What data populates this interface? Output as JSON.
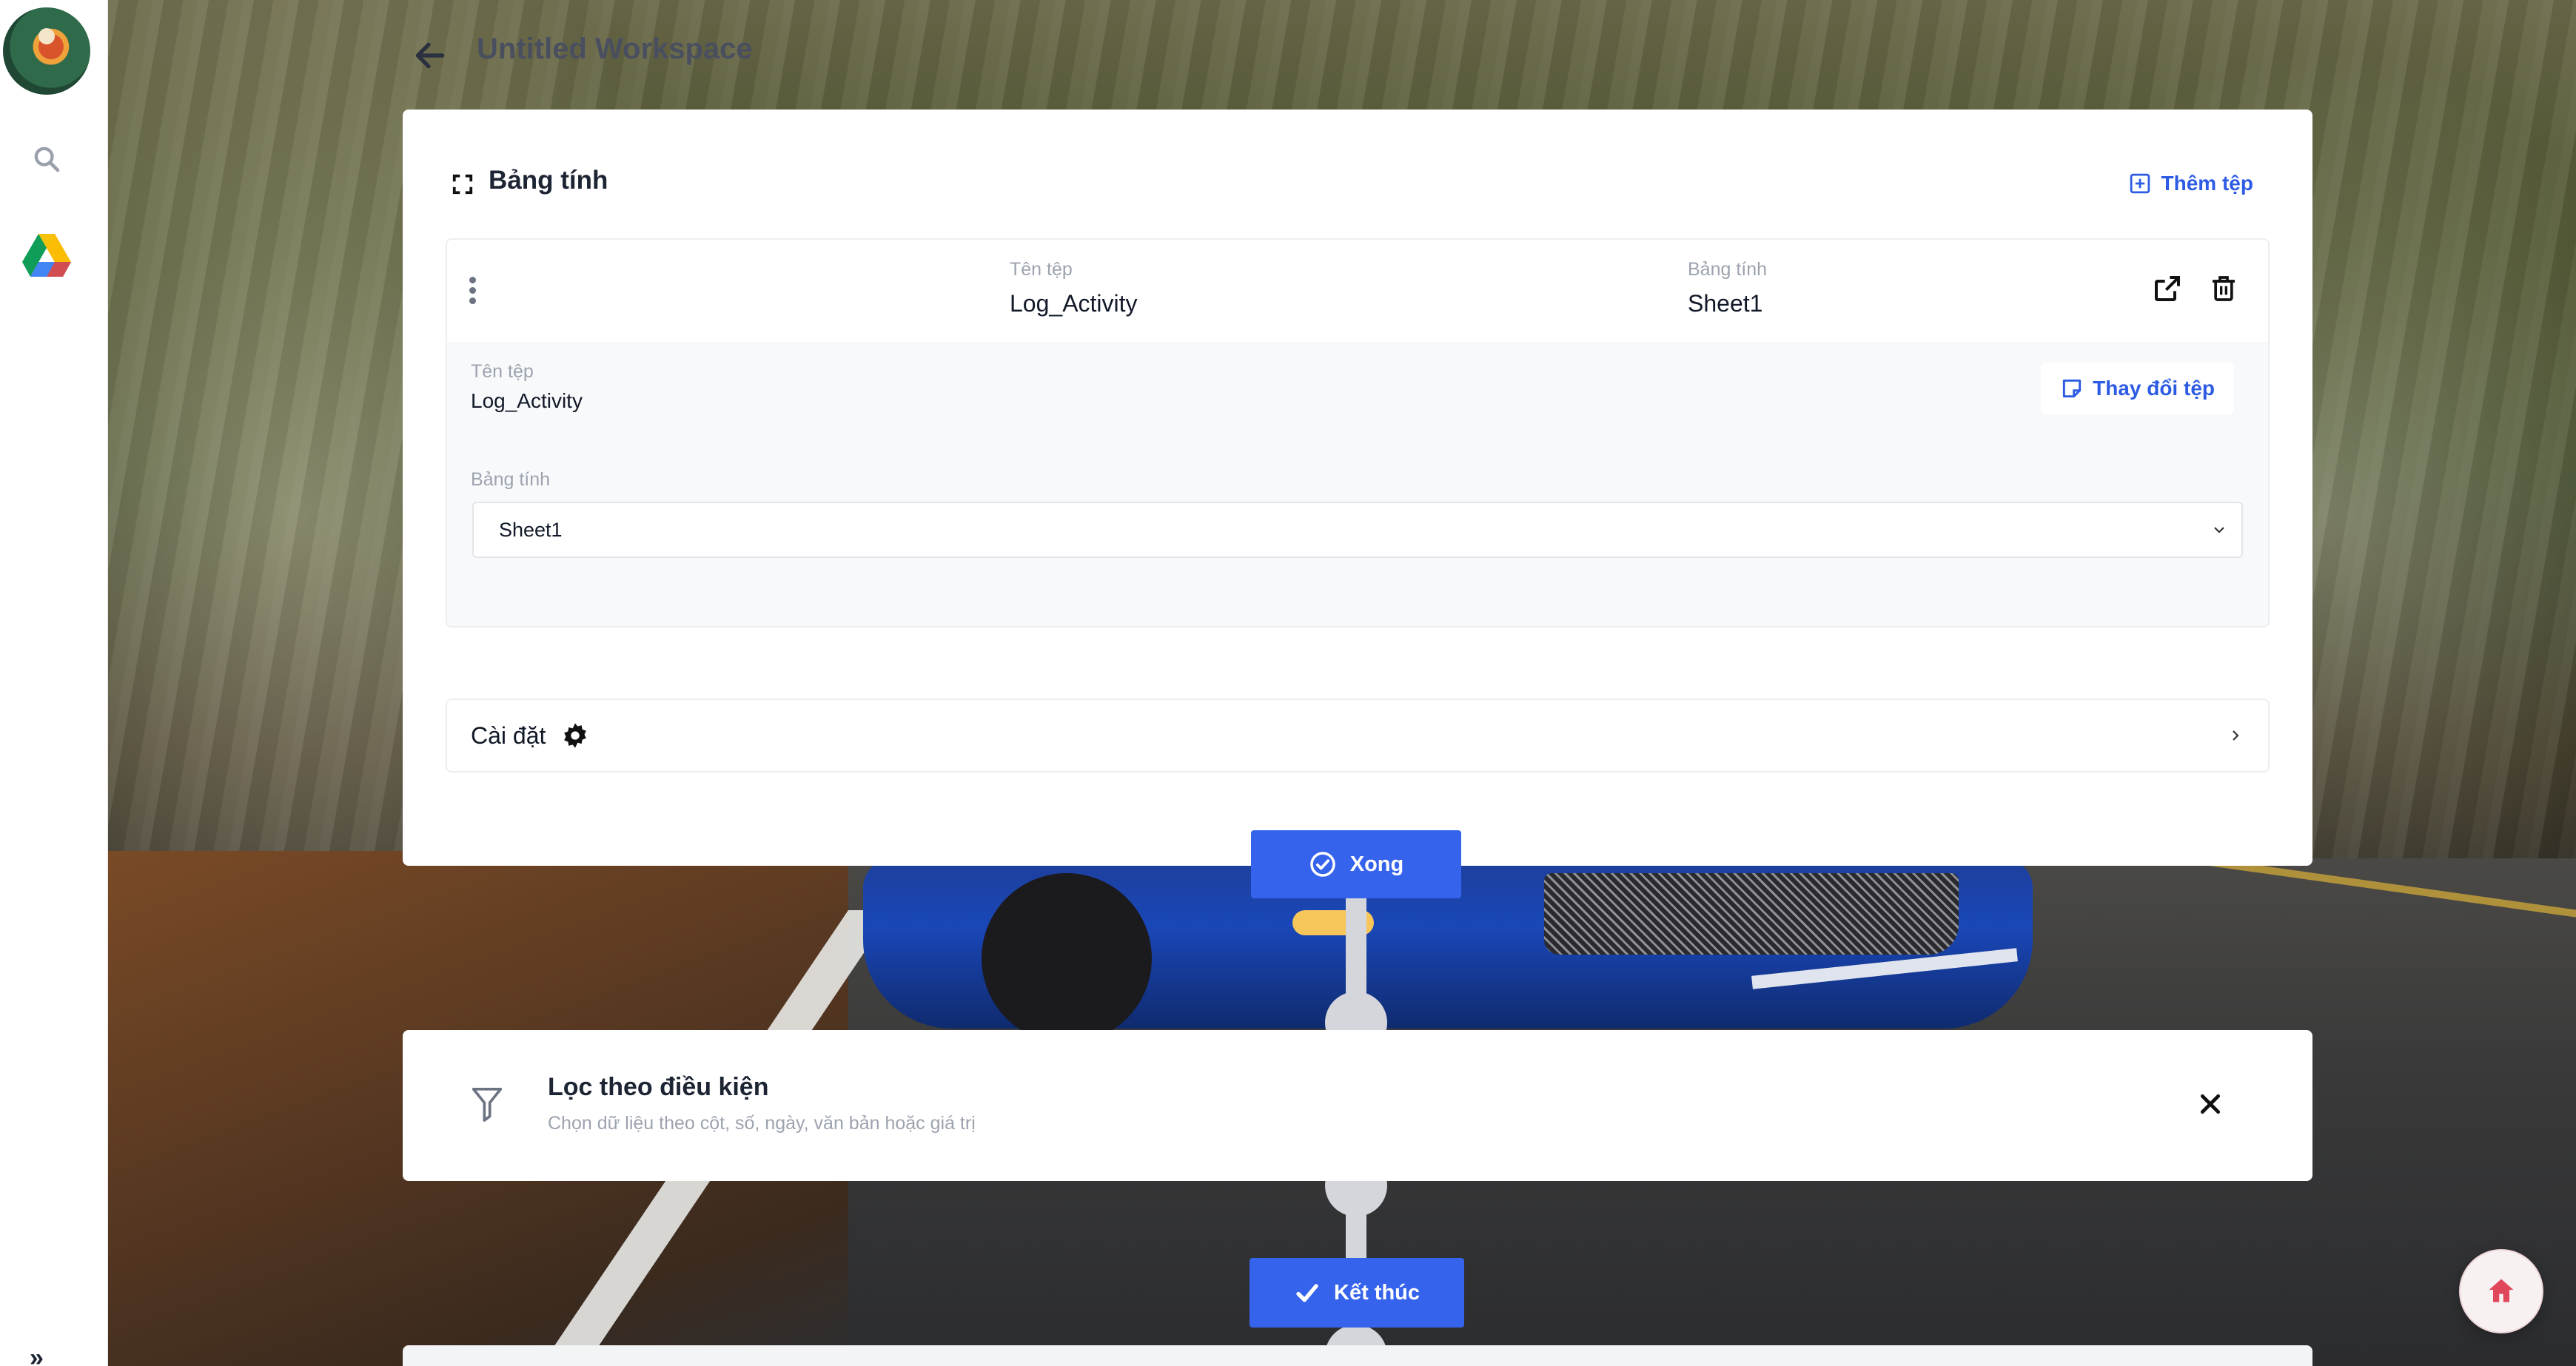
{
  "header": {
    "workspace_title": "Untitled Workspace"
  },
  "sheet_card": {
    "title": "Bảng tính",
    "add_file_label": "Thêm tệp",
    "row": {
      "file_name_label": "Tên tệp",
      "file_name": "Log_Activity",
      "sheet_label": "Bảng tính",
      "sheet": "Sheet1"
    },
    "details": {
      "file_name_label": "Tên tệp",
      "file_name": "Log_Activity",
      "change_file_label": "Thay đổi tệp",
      "sheet_label": "Bảng tính",
      "sheet_selected": "Sheet1"
    },
    "settings_label": "Cài đặt",
    "done_label": "Xong"
  },
  "filter_card": {
    "title": "Lọc theo điều kiện",
    "subtitle": "Chọn dữ liệu theo cột, số, ngày, văn bản hoặc giá trị"
  },
  "finish_label": "Kết thúc",
  "colors": {
    "accent": "#3563eb",
    "link": "#2d5be3",
    "connector": "#d4d6dc",
    "home_icon": "#e0475a"
  },
  "icons": {
    "sidebar": [
      "search-icon",
      "google-drive-icon",
      "expand-icon"
    ],
    "header": [
      "back-arrow-icon"
    ],
    "card": [
      "fullscreen-icon",
      "add-file-icon",
      "external-link-icon",
      "trash-icon",
      "note-icon",
      "chevron-down-icon",
      "gear-icon",
      "chevron-right-icon",
      "check-circle-icon"
    ],
    "filter": [
      "filter-icon",
      "close-icon",
      "check-icon"
    ],
    "fab": [
      "home-icon"
    ]
  }
}
